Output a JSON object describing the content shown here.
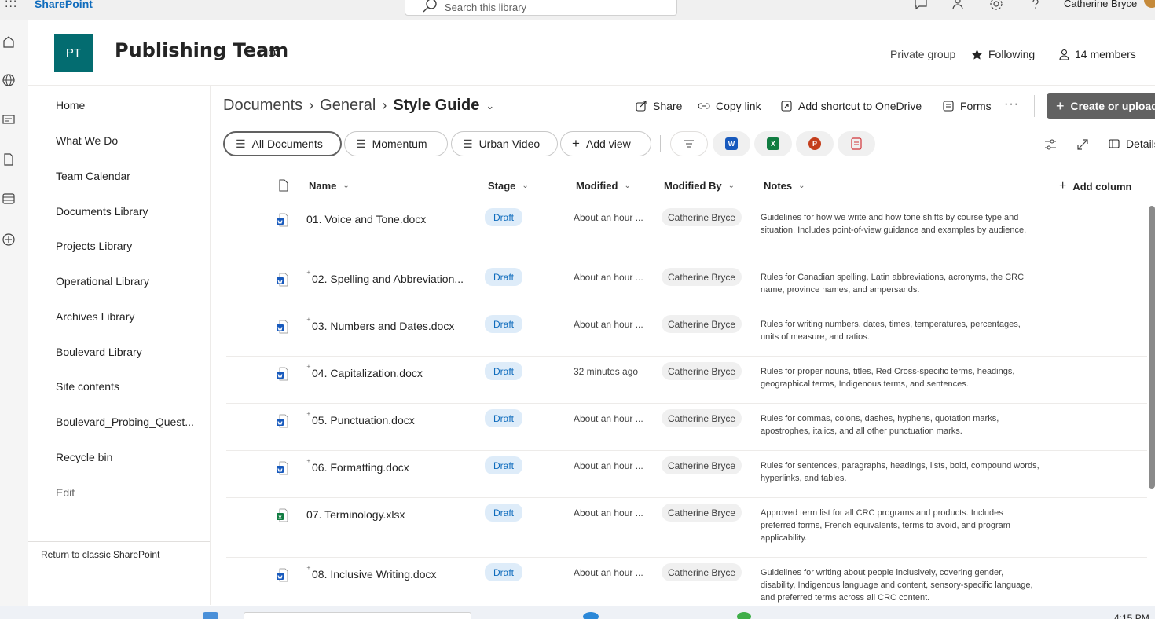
{
  "topbar": {
    "app_name": "SharePoint",
    "search_placeholder": "Search this library",
    "user_name": "Catherine Bryce"
  },
  "site": {
    "logo_initials": "PT",
    "title": "Publishing Team",
    "privacy": "Private group",
    "follow_label": "Following",
    "members_label": "14 members",
    "accent_color": "#036c70"
  },
  "leftnav": {
    "items": [
      {
        "label": "Home"
      },
      {
        "label": "What We Do"
      },
      {
        "label": "Team Calendar"
      },
      {
        "label": "Documents Library"
      },
      {
        "label": "Projects Library"
      },
      {
        "label": "Operational Library"
      },
      {
        "label": "Archives Library"
      },
      {
        "label": "Boulevard Library"
      },
      {
        "label": "Site contents"
      },
      {
        "label": "Boulevard_Probing_Quest..."
      },
      {
        "label": "Recycle bin"
      }
    ],
    "edit_label": "Edit",
    "classic_label": "Return to classic SharePoint"
  },
  "breadcrumb": {
    "root": "Documents",
    "middle": "General",
    "current": "Style Guide"
  },
  "commands": {
    "share": "Share",
    "copy_link": "Copy link",
    "add_shortcut": "Add shortcut to OneDrive",
    "forms": "Forms",
    "more": "···",
    "create": "Create or upload"
  },
  "views": {
    "all_documents": "All Documents",
    "momentum": "Momentum",
    "urban_video": "Urban Video",
    "add_view": "Add view",
    "details": "Details"
  },
  "table": {
    "columns": {
      "name": "Name",
      "stage": "Stage",
      "modified": "Modified",
      "modified_by": "Modified By",
      "notes": "Notes",
      "add_column": "Add column"
    },
    "rows": [
      {
        "name": "01. Voice and Tone.docx",
        "type": "word",
        "new": false,
        "stage": "Draft",
        "modified": "About an hour ...",
        "modified_by": "Catherine Bryce",
        "notes": "Guidelines for how we write and how tone shifts by course type and situation. Includes point-of-view guidance and examples by audience."
      },
      {
        "name": "02. Spelling and Abbreviation...",
        "type": "word",
        "new": true,
        "stage": "Draft",
        "modified": "About an hour ...",
        "modified_by": "Catherine Bryce",
        "notes": "Rules for Canadian spelling, Latin abbreviations, acronyms, the CRC name, province names, and ampersands."
      },
      {
        "name": "03. Numbers and Dates.docx",
        "type": "word",
        "new": true,
        "stage": "Draft",
        "modified": "About an hour ...",
        "modified_by": "Catherine Bryce",
        "notes": "Rules for writing numbers, dates, times, temperatures, percentages, units of measure, and ratios."
      },
      {
        "name": "04. Capitalization.docx",
        "type": "word",
        "new": true,
        "stage": "Draft",
        "modified": "32 minutes ago",
        "modified_by": "Catherine Bryce",
        "notes": "Rules for proper nouns, titles, Red Cross-specific terms, headings, geographical terms, Indigenous terms, and sentences."
      },
      {
        "name": "05. Punctuation.docx",
        "type": "word",
        "new": true,
        "stage": "Draft",
        "modified": "About an hour ...",
        "modified_by": "Catherine Bryce",
        "notes": "Rules for commas, colons, dashes, hyphens, quotation marks, apostrophes, italics, and all other punctuation marks."
      },
      {
        "name": "06. Formatting.docx",
        "type": "word",
        "new": true,
        "stage": "Draft",
        "modified": "About an hour ...",
        "modified_by": "Catherine Bryce",
        "notes": "Rules for sentences, paragraphs, headings, lists, bold, compound words, hyperlinks, and tables."
      },
      {
        "name": "07. Terminology.xlsx",
        "type": "excel",
        "new": false,
        "stage": "Draft",
        "modified": "About an hour ...",
        "modified_by": "Catherine Bryce",
        "notes": "Approved term list for all CRC programs and products. Includes preferred forms, French equivalents, terms to avoid, and program applicability."
      },
      {
        "name": "08. Inclusive Writing.docx",
        "type": "word",
        "new": true,
        "stage": "Draft",
        "modified": "About an hour ...",
        "modified_by": "Catherine Bryce",
        "notes": "Guidelines for writing about people inclusively, covering gender, disability, Indigenous language and content, sensory-specific language, and preferred terms across all CRC content."
      }
    ]
  },
  "taskbar": {
    "time": "4:15 PM"
  }
}
